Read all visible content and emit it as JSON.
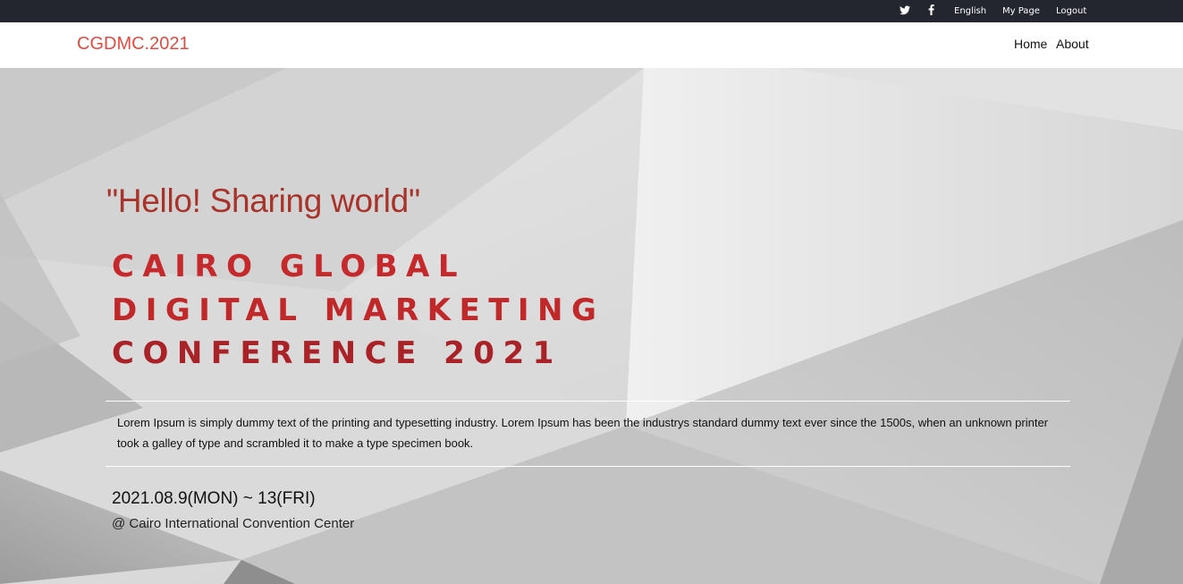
{
  "topbar": {
    "twitter_icon": "twitter-icon",
    "facebook_icon": "facebook-icon",
    "language": "English",
    "my_page": "My Page",
    "logout": "Logout"
  },
  "header": {
    "brand": "CGDMC.2021",
    "nav": [
      {
        "label": "Home"
      },
      {
        "label": "About"
      }
    ]
  },
  "hero": {
    "quote": "\"Hello! Sharing world\"",
    "title_lines": [
      "CAIRO GLOBAL",
      "DIGITAL MARKETING",
      "CONFERENCE 2021"
    ],
    "description": "Lorem Ipsum is simply dummy text of the printing and typesetting industry. Lorem Ipsum has been the industrys standard dummy text ever since the 1500s, when an unknown printer took a galley of type and scrambled it to make a type specimen book.",
    "date": "2021.08.9(MON) ~ 13(FRI)",
    "venue": "@ Cairo International Convention Center"
  },
  "colors": {
    "topbar_bg": "#23262e",
    "brand": "#e64a3e",
    "quote": "#a8332b",
    "title": "#c1282a"
  }
}
